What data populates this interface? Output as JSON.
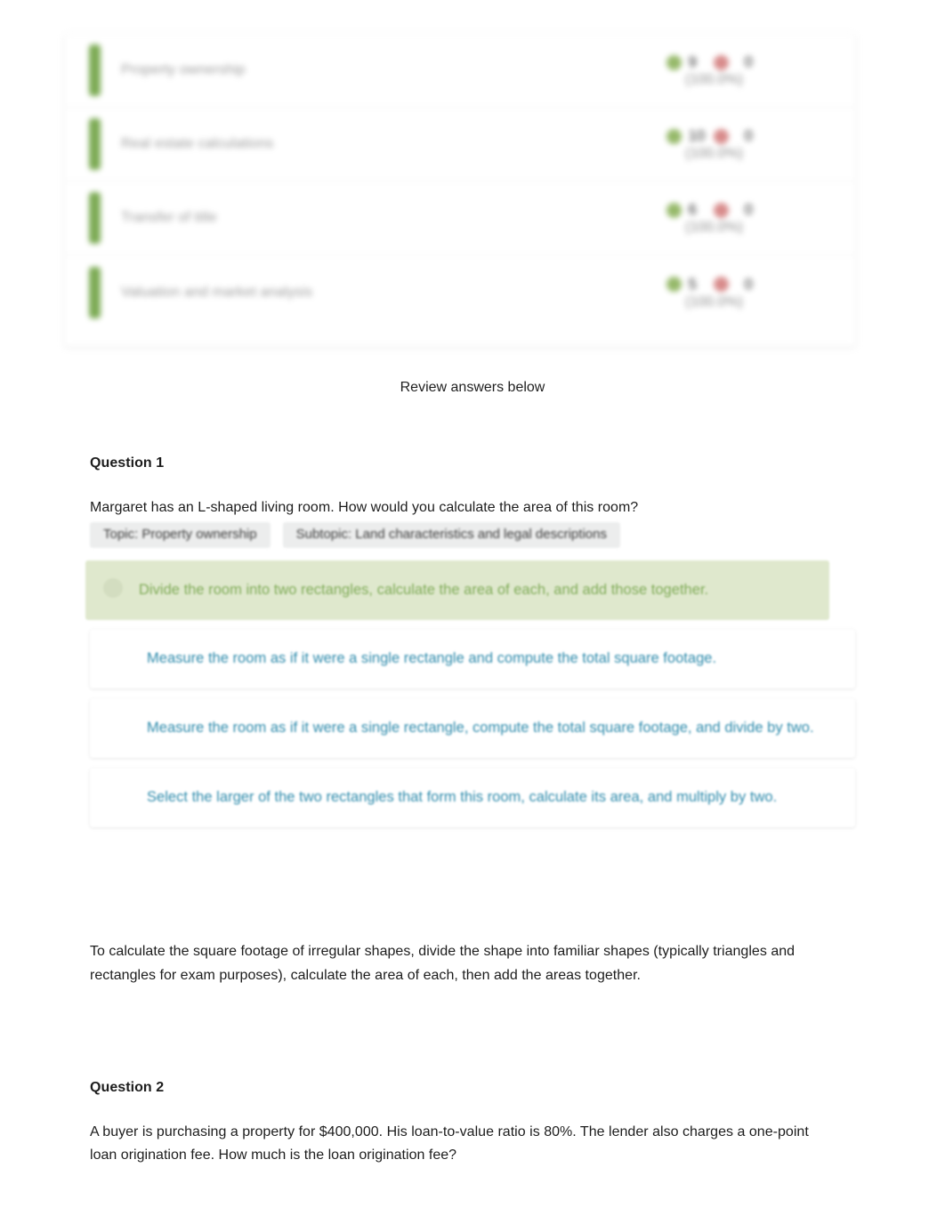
{
  "summary": {
    "columns": [
      "topic",
      "correct_count",
      "incorrect_count",
      "percent"
    ],
    "rows": [
      {
        "topic": "Property ownership",
        "correct": "9",
        "incorrect": "0",
        "percent": "(100.0%)"
      },
      {
        "topic": "Real estate calculations",
        "correct": "10",
        "incorrect": "0",
        "percent": "(100.0%)"
      },
      {
        "topic": "Transfer of title",
        "correct": "6",
        "incorrect": "0",
        "percent": "(100.0%)"
      },
      {
        "topic": "Valuation and market analysis",
        "correct": "5",
        "incorrect": "0",
        "percent": "(100.0%)"
      }
    ],
    "correct_icon": "check-circle-icon",
    "incorrect_icon": "x-circle-icon"
  },
  "review_header": "Review answers below",
  "questions": [
    {
      "title": "Question 1",
      "text": "Margaret has an L-shaped living room. How would you calculate the area of this room?",
      "topic_tag": "Topic: Property ownership",
      "subtopic_tag": "Subtopic: Land characteristics and legal descriptions",
      "options": [
        {
          "text": "Divide the room into two rectangles, calculate the area of each, and add those together.",
          "state": "correct"
        },
        {
          "text": "Measure the room as if it were a single rectangle and compute the total square footage.",
          "state": "normal"
        },
        {
          "text": "Measure the room as if it were a single rectangle, compute the total square footage, and divide by two.",
          "state": "normal"
        },
        {
          "text": "Select the larger of the two rectangles that form this room, calculate its area, and multiply by two.",
          "state": "normal"
        }
      ],
      "explanation": "To calculate the square footage of irregular shapes, divide the shape into familiar shapes (typically triangles and rectangles for exam purposes), calculate the area of each, then add the areas together."
    },
    {
      "title": "Question 2",
      "text": "A buyer is purchasing a property for $400,000. His loan-to-value ratio is 80%. The lender also charges a one-point loan origination fee. How much is the loan origination fee?"
    }
  ],
  "colors": {
    "correct_green_text": "#7fab57",
    "correct_green_bg": "#dfe8cd",
    "option_teal_text": "#2d8aab",
    "topic_bar_green": "#7cab54",
    "tag_bg": "#eceded"
  }
}
